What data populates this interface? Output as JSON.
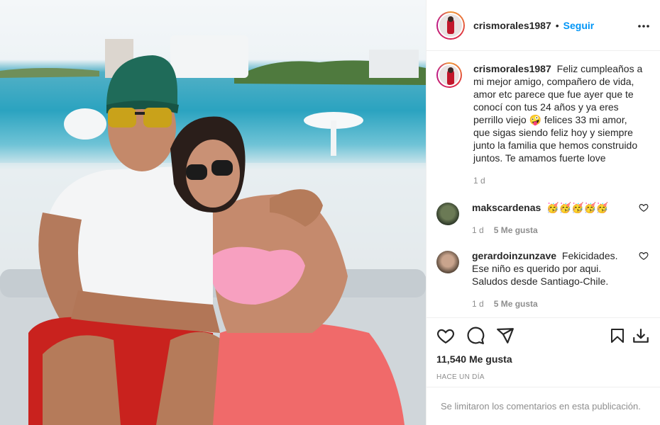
{
  "post": {
    "username": "crismorales1987",
    "separator": "•",
    "follow_label": "Seguir",
    "more_label": "•••"
  },
  "caption": {
    "username": "crismorales1987",
    "text": "Feliz cumpleaños a mi mejor amigo, compañero de vida, amor etc parece que fue ayer que te conocí con tus 24 años y ya eres perrillo viejo 🤪 felices 33 mi amor, que sigas siendo feliz hoy y siempre junto la familia que hemos construido juntos. Te amamos fuerte love",
    "age": "1 d"
  },
  "comments": [
    {
      "username": "makscardenas",
      "text": "🥳🥳🥳🥳🥳",
      "age": "1 d",
      "likes": "5 Me gusta"
    },
    {
      "username": "gerardoinzunzave",
      "text": "Fekicidades. Ese niño es querido por aqui. Saludos desde Santiago-Chile.",
      "age": "1 d",
      "likes": "5 Me gusta"
    }
  ],
  "footer": {
    "likes": "11,540 Me gusta",
    "time": "HACE UN DÍA",
    "comments_limited": "Se limitaron los comentarios en esta publicación."
  },
  "icons": [
    "heart-icon",
    "comment-icon",
    "share-icon",
    "bookmark-icon",
    "download-icon",
    "more-icon"
  ],
  "colors": {
    "accent": "#0095f6",
    "text": "#262626",
    "muted": "#8e8e8e",
    "border": "#efefef"
  }
}
